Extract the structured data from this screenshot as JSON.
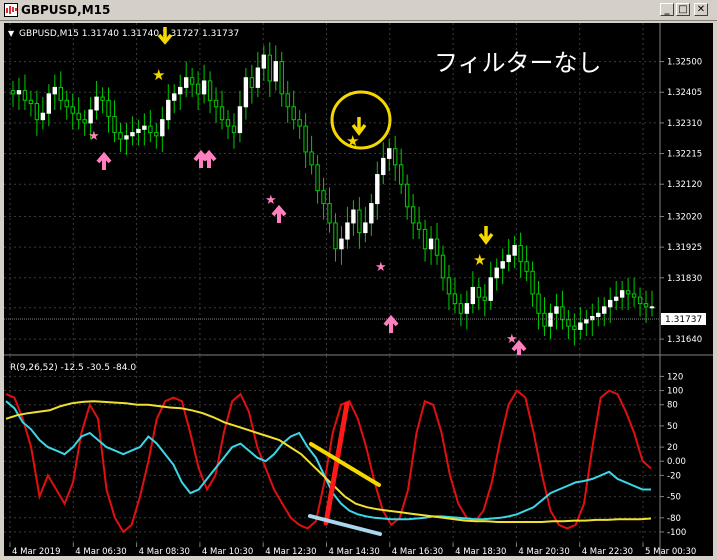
{
  "window": {
    "title": "GBPUSD,M15",
    "minimize_glyph": "_",
    "maximize_glyph": "□",
    "close_glyph": "✕"
  },
  "chart": {
    "symbol_header": "GBPUSD,M15  1.31740 1.31740 1.31727 1.31737",
    "annotation": "フィルターなし",
    "current_price_label": "1.31737",
    "price_ticks": [
      "1.32500",
      "1.32405",
      "1.32310",
      "1.32215",
      "1.32120",
      "1.32020",
      "1.31925",
      "1.31830",
      "1.31737",
      "1.31640"
    ],
    "time_ticks": [
      "4 Mar 2019",
      "4 Mar 06:30",
      "4 Mar 08:30",
      "4 Mar 10:30",
      "4 Mar 12:30",
      "4 Mar 14:30",
      "4 Mar 16:30",
      "4 Mar 18:30",
      "4 Mar 20:30",
      "4 Mar 22:30",
      "5 Mar 00:30"
    ]
  },
  "indicator": {
    "header": "R(9,26,52) -12.5 -30.5 -84.0",
    "ticks": [
      "120",
      "100",
      "80",
      "50",
      "20",
      "0.00",
      "-20",
      "-50",
      "-80",
      "-100"
    ]
  },
  "colors": {
    "background": "#000000",
    "grid": "#3a3a3a",
    "candle_up": "#ffffff",
    "candle_down": "#00cc00",
    "series_fast": "#e01010",
    "series_mid": "#3ad7e8",
    "series_slow": "#f0e030",
    "arrow_down": "#f5d800",
    "arrow_up": "#ff7fbf",
    "star_yellow": "#f5d800",
    "star_pink": "#ff7fbf"
  },
  "chart_data": [
    {
      "type": "candlestick",
      "title": "GBPUSD,M15",
      "ylim": [
        1.316,
        1.3257
      ],
      "candles_close": [
        1.324,
        1.3241,
        1.3238,
        1.3237,
        1.3232,
        1.3234,
        1.324,
        1.3242,
        1.3238,
        1.3236,
        1.3234,
        1.3232,
        1.3231,
        1.3235,
        1.3239,
        1.3238,
        1.3233,
        1.3228,
        1.3226,
        1.3227,
        1.3228,
        1.3229,
        1.323,
        1.3228,
        1.3227,
        1.3232,
        1.3238,
        1.324,
        1.3242,
        1.3245,
        1.3243,
        1.324,
        1.3244,
        1.3238,
        1.3236,
        1.3232,
        1.323,
        1.3228,
        1.3236,
        1.3245,
        1.3242,
        1.3248,
        1.3252,
        1.3244,
        1.325,
        1.324,
        1.3236,
        1.3232,
        1.323,
        1.3222,
        1.3218,
        1.321,
        1.3206,
        1.32,
        1.3192,
        1.3195,
        1.32,
        1.3204,
        1.3197,
        1.32,
        1.3206,
        1.3215,
        1.322,
        1.3223,
        1.3218,
        1.3212,
        1.3205,
        1.32,
        1.3198,
        1.3192,
        1.3195,
        1.319,
        1.3183,
        1.3178,
        1.3175,
        1.3172,
        1.3175,
        1.318,
        1.3177,
        1.3176,
        1.3183,
        1.3186,
        1.3188,
        1.319,
        1.3193,
        1.3188,
        1.3185,
        1.3178,
        1.3172,
        1.3168,
        1.3172,
        1.3174,
        1.317,
        1.3168,
        1.3167,
        1.3169,
        1.317,
        1.3171,
        1.3172,
        1.3174,
        1.3176,
        1.3177,
        1.3179,
        1.3178,
        1.3177,
        1.3175,
        1.3174,
        1.3174
      ]
    },
    {
      "type": "line",
      "title": "R(9,26,52)",
      "ylim": [
        -110,
        122
      ],
      "series": [
        {
          "values": [
            95,
            90,
            60,
            20,
            -50,
            -20,
            -40,
            -60,
            -30,
            40,
            80,
            60,
            -40,
            -80,
            -100,
            -90,
            -50,
            0,
            60,
            85,
            90,
            85,
            40,
            -10,
            -40,
            -20,
            40,
            85,
            95,
            70,
            20,
            -10,
            -40,
            -60,
            -80,
            -90,
            -95,
            -85,
            -30,
            40,
            80,
            85,
            60,
            20,
            -30,
            -70,
            -90,
            -80,
            -40,
            40,
            85,
            80,
            40,
            -20,
            -60,
            -80,
            -85,
            -70,
            -30,
            30,
            80,
            100,
            90,
            40,
            -20,
            -70,
            -90,
            -95,
            -90,
            -60,
            20,
            90,
            100,
            95,
            70,
            40,
            0,
            -10
          ]
        },
        {
          "values": [
            85,
            75,
            55,
            45,
            30,
            20,
            15,
            10,
            20,
            35,
            40,
            30,
            20,
            15,
            10,
            15,
            20,
            35,
            25,
            10,
            -5,
            -30,
            -45,
            -40,
            -25,
            -10,
            5,
            20,
            25,
            15,
            5,
            0,
            10,
            25,
            35,
            40,
            20,
            5,
            -20,
            -45,
            -60,
            -70,
            -75,
            -78,
            -80,
            -81,
            -82,
            -82,
            -82,
            -81,
            -80,
            -78,
            -78,
            -79,
            -80,
            -81,
            -82,
            -82,
            -81,
            -80,
            -78,
            -75,
            -70,
            -65,
            -55,
            -45,
            -40,
            -35,
            -30,
            -28,
            -25,
            -20,
            -15,
            -25,
            -30,
            -35,
            -40,
            -40
          ]
        },
        {
          "values": [
            60,
            65,
            68,
            70,
            72,
            78,
            82,
            84,
            85,
            84,
            83,
            82,
            80,
            80,
            78,
            76,
            75,
            72,
            68,
            62,
            55,
            50,
            45,
            40,
            35,
            30,
            20,
            10,
            -5,
            -20,
            -35,
            -50,
            -60,
            -65,
            -68,
            -70,
            -72,
            -74,
            -76,
            -78,
            -80,
            -82,
            -84,
            -85,
            -85,
            -86,
            -86,
            -86,
            -86,
            -86,
            -85,
            -85,
            -84,
            -84,
            -83,
            -83,
            -82,
            -82,
            -82,
            -81
          ]
        }
      ]
    }
  ]
}
